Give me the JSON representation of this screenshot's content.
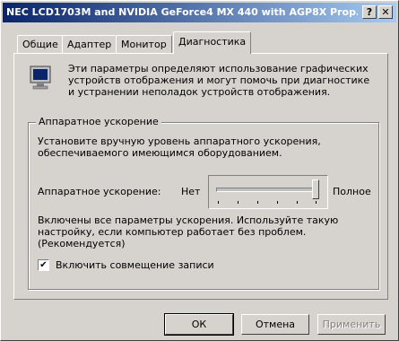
{
  "window": {
    "title": "NEC LCD1703M and NVIDIA GeForce4 MX 440 with AGP8X Prop..."
  },
  "titlebar": {
    "help_label": "?",
    "close_label": "✕"
  },
  "tabs": [
    {
      "label": "Общие"
    },
    {
      "label": "Адаптер"
    },
    {
      "label": "Монитор"
    },
    {
      "label": "Диагностика"
    }
  ],
  "intro_text": "Эти параметры определяют использование графических устройств отображения и могут помочь при диагностике и устранении неполадок устройств отображения.",
  "accel_group": {
    "title": "Аппаратное ускорение",
    "description": "Установите вручную уровень аппаратного ускорения, обеспечиваемого имеющимся оборудованием.",
    "slider_label": "Аппаратное ускорение:",
    "min_label": "Нет",
    "max_label": "Полное",
    "slider_level": 1.0,
    "status_text": "Включены все параметры ускорения. Используйте такую настройку, если компьютер работает без проблем. (Рекомендуется)"
  },
  "write_combining": {
    "label": "Включить совмещение записи",
    "checked": true,
    "check_glyph": "✔"
  },
  "buttons": {
    "ok": "ОК",
    "cancel": "Отмена",
    "apply": "Применить"
  }
}
